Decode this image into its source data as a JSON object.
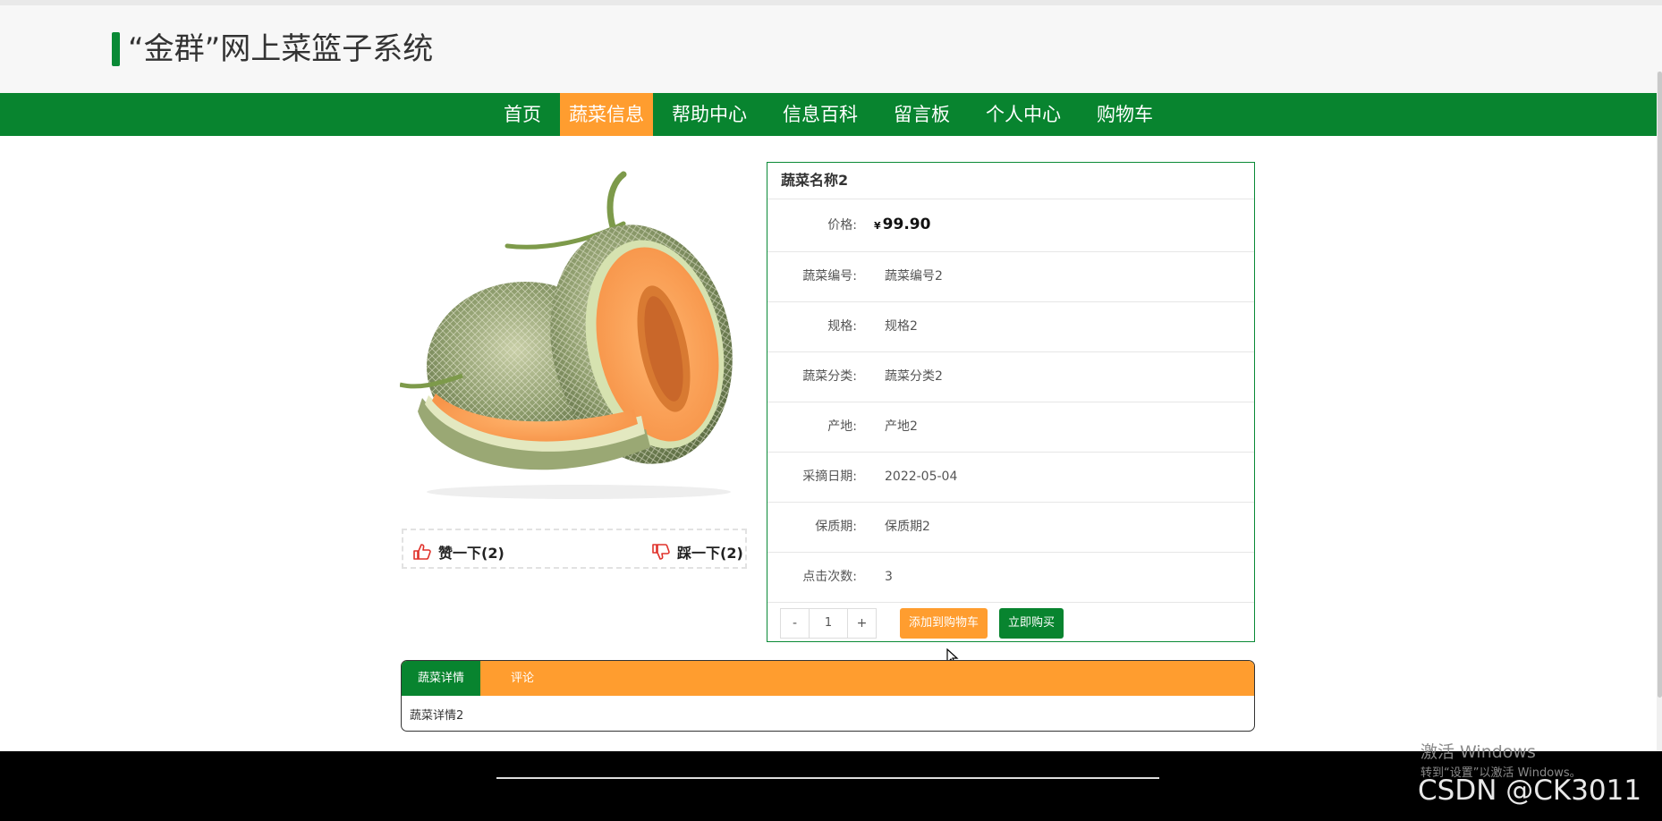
{
  "header": {
    "title": "“金群”网上菜篮子系统"
  },
  "nav": {
    "items": [
      {
        "label": "首页"
      },
      {
        "label": "蔬菜信息"
      },
      {
        "label": "帮助中心"
      },
      {
        "label": "信息百科"
      },
      {
        "label": "留言板"
      },
      {
        "label": "个人中心"
      },
      {
        "label": "购物车"
      }
    ],
    "active_index": 1
  },
  "votes": {
    "like_label": "赞一下(2)",
    "dislike_label": "踩一下(2)"
  },
  "product": {
    "name": "蔬菜名称2",
    "price_label": "价格:",
    "currency": "¥",
    "price": "99.90",
    "fields": [
      {
        "label": "蔬菜编号:",
        "value": "蔬菜编号2"
      },
      {
        "label": "规格:",
        "value": "规格2"
      },
      {
        "label": "蔬菜分类:",
        "value": "蔬菜分类2"
      },
      {
        "label": "产地:",
        "value": "产地2"
      },
      {
        "label": "采摘日期:",
        "value": "2022-05-04"
      },
      {
        "label": "保质期:",
        "value": "保质期2"
      },
      {
        "label": "点击次数:",
        "value": "3"
      }
    ],
    "quantity": {
      "minus": "-",
      "value": "1",
      "plus": "+"
    },
    "add_to_cart": "添加到购物车",
    "buy_now": "立即购买"
  },
  "tabs": {
    "items": [
      {
        "label": "蔬菜详情"
      },
      {
        "label": "评论"
      }
    ],
    "content": "蔬菜详情2"
  },
  "watermark": {
    "line1": "激活 Windows",
    "line2": "转到“设置”以激活 Windows。",
    "csdn": "CSDN @CK3011"
  },
  "colors": {
    "brand_green": "#08842f",
    "accent_orange": "#ff9d2f",
    "vote_red": "#e0322b"
  }
}
